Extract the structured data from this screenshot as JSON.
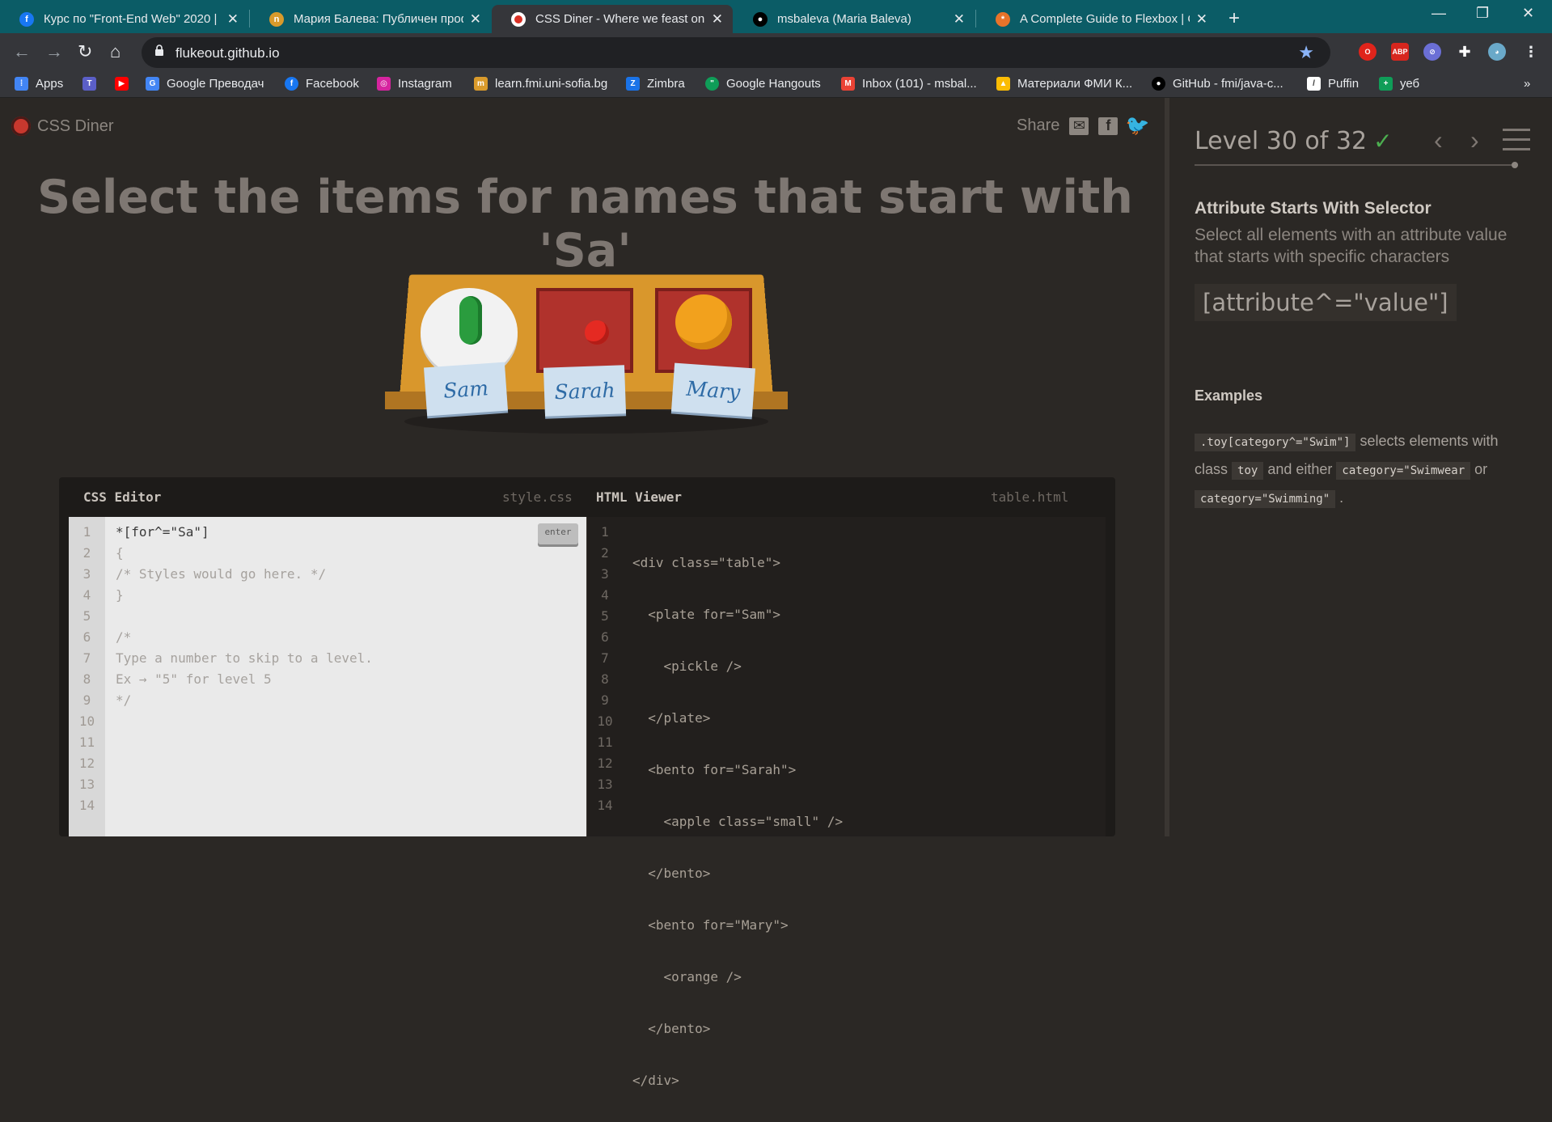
{
  "browser": {
    "tabs": [
      {
        "title": "Курс по \"Front-End Web\" 2020 |",
        "favicon": "facebook-icon",
        "active": false
      },
      {
        "title": "Мария Балева: Публичен профи",
        "favicon": "softuni-icon",
        "active": false
      },
      {
        "title": "CSS Diner - Where we feast on C",
        "favicon": "css-diner-icon",
        "active": true
      },
      {
        "title": "msbaleva (Maria Baleva)",
        "favicon": "github-icon",
        "active": false
      },
      {
        "title": "A Complete Guide to Flexbox | C",
        "favicon": "css-tricks-icon",
        "active": false
      }
    ],
    "url": "flukeout.github.io",
    "bookmarks": [
      {
        "label": "Apps"
      },
      {
        "label": ""
      },
      {
        "label": ""
      },
      {
        "label": "Google Преводач"
      },
      {
        "label": "Facebook"
      },
      {
        "label": "Instagram"
      },
      {
        "label": "learn.fmi.uni-sofia.bg"
      },
      {
        "label": "Zimbra"
      },
      {
        "label": "Google Hangouts"
      },
      {
        "label": "Inbox (101) - msbal..."
      },
      {
        "label": "Материали ФМИ К..."
      },
      {
        "label": "GitHub - fmi/java-c..."
      },
      {
        "label": "Puffin"
      },
      {
        "label": "уеб"
      }
    ],
    "extensions": [
      "opera-icon",
      "adblock-icon",
      "block-icon",
      "puzzle-icon",
      "avatar-icon"
    ]
  },
  "app": {
    "logo": "CSS Diner",
    "share": "Share",
    "order": "Select the items for names that start with 'Sa'",
    "nametags": [
      "Sam",
      "Sarah",
      "Mary"
    ],
    "css_editor": {
      "title": "CSS Editor",
      "file": "style.css",
      "input": "*[for^=\"Sa\"]",
      "enter": "enter",
      "lines": [
        "{",
        "/* Styles would go here. */",
        "}",
        "",
        "/*",
        "Type a number to skip to a level.",
        "Ex → \"5\" for level 5",
        "*/"
      ],
      "line_numbers": [
        "1",
        "2",
        "3",
        "4",
        "5",
        "6",
        "7",
        "8",
        "9",
        "10",
        "11",
        "12",
        "13",
        "14"
      ]
    },
    "html_viewer": {
      "title": "HTML Viewer",
      "file": "table.html",
      "lines": [
        "<div class=\"table\">",
        "  <plate for=\"Sam\">",
        "    <pickle />",
        "  </plate>",
        "  <bento for=\"Sarah\">",
        "    <apple class=\"small\" />",
        "  </bento>",
        "  <bento for=\"Mary\">",
        "    <orange />",
        "  </bento>",
        "</div>",
        "",
        "",
        ""
      ],
      "line_numbers": [
        "1",
        "2",
        "3",
        "4",
        "5",
        "6",
        "7",
        "8",
        "9",
        "10",
        "11",
        "12",
        "13",
        "14"
      ]
    }
  },
  "sidebar": {
    "level": "Level 30 of 32",
    "check": "✓",
    "selector_name": "Attribute Starts With Selector",
    "selector_desc": "Select all elements with an attribute value that starts with specific characters",
    "syntax": "[attribute^=\"value\"]",
    "examples_title": "Examples",
    "example": {
      "code1": ".toy[category^=\"Swim\"]",
      "text1": "selects elements with class",
      "code2": "toy",
      "text2": "and either",
      "code3": "category=\"Swimwear",
      "text3": "or",
      "code4": "category=\"Swimming\"",
      "text4": "."
    }
  }
}
